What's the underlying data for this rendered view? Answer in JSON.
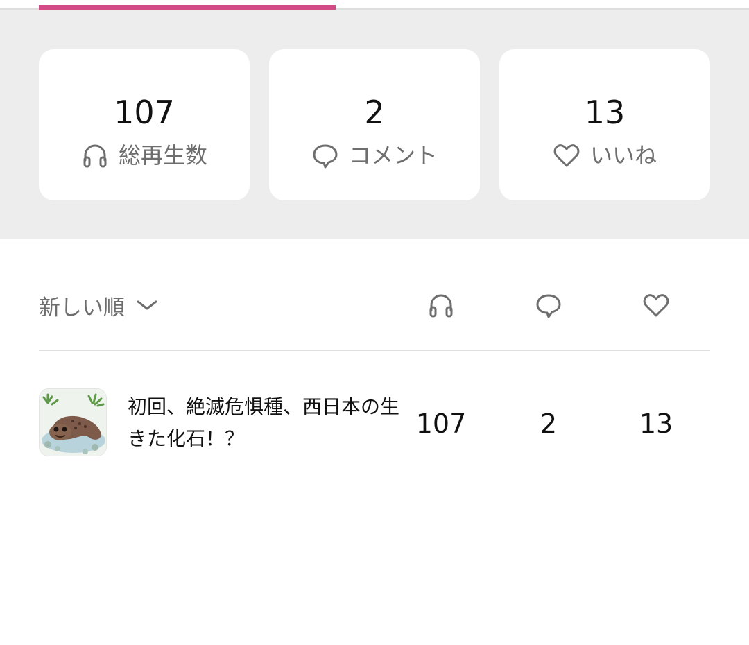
{
  "stats": {
    "plays": {
      "value": "107",
      "label": "総再生数",
      "icon": "headphones-icon"
    },
    "comments": {
      "value": "2",
      "label": "コメント",
      "icon": "speech-bubble-icon"
    },
    "likes": {
      "value": "13",
      "label": "いいね",
      "icon": "heart-icon"
    }
  },
  "sort": {
    "label": "新しい順",
    "icon": "chevron-down-icon"
  },
  "columns": [
    "headphones-icon",
    "speech-bubble-icon",
    "heart-icon"
  ],
  "episodes": [
    {
      "title": "初回、絶滅危惧種、西日本の生きた化石！？",
      "plays": "107",
      "comments": "2",
      "likes": "13"
    }
  ],
  "colors": {
    "accent": "#d24a86",
    "panel_bg": "#ededed",
    "icon_gray": "#6e6e6e"
  }
}
